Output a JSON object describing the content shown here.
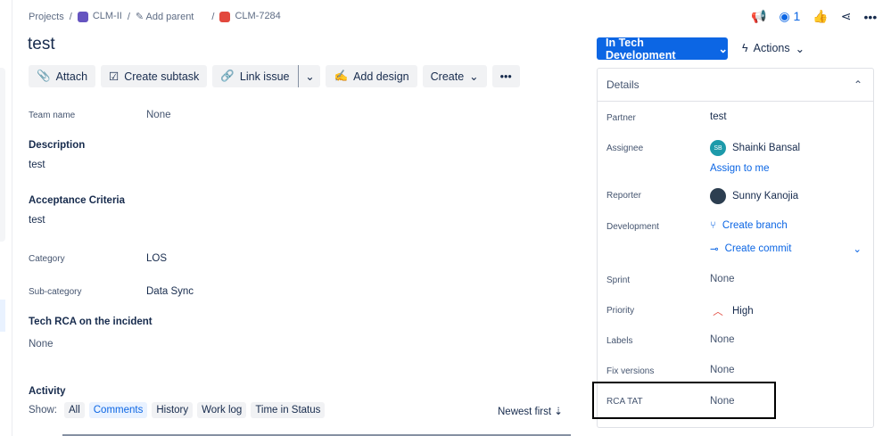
{
  "breadcrumb": {
    "projects": "Projects",
    "project": "CLM-II",
    "add_parent": "Add parent",
    "issue_key": "CLM-7284"
  },
  "title": "test",
  "toolbar": {
    "attach": "Attach",
    "create_subtask": "Create subtask",
    "link_issue": "Link issue",
    "add_design": "Add design",
    "create": "Create"
  },
  "fields": {
    "team_name_label": "Team name",
    "team_name": "None",
    "description_label": "Description",
    "description": "test",
    "acceptance_label": "Acceptance Criteria",
    "acceptance": "test",
    "category_label": "Category",
    "category": "LOS",
    "subcategory_label": "Sub-category",
    "subcategory": "Data Sync",
    "rca_label": "Tech RCA on the incident",
    "rca": "None"
  },
  "activity": {
    "title": "Activity",
    "show": "Show:",
    "filters": [
      "All",
      "Comments",
      "History",
      "Work log",
      "Time in Status"
    ],
    "sort": "Newest first"
  },
  "header": {
    "watchers": "1",
    "status": "In Tech Development",
    "actions": "Actions"
  },
  "details": {
    "title": "Details",
    "partner_label": "Partner",
    "partner": "test",
    "assignee_label": "Assignee",
    "assignee": "Shainki Bansal",
    "assignee_initials": "SB",
    "assign_to_me": "Assign to me",
    "reporter_label": "Reporter",
    "reporter": "Sunny Kanojia",
    "development_label": "Development",
    "create_branch": "Create branch",
    "create_commit": "Create commit",
    "sprint_label": "Sprint",
    "sprint": "None",
    "priority_label": "Priority",
    "priority": "High",
    "labels_label": "Labels",
    "labels": "None",
    "fix_label": "Fix versions",
    "fix": "None",
    "rcatat_label": "RCA TAT",
    "rcatat": "None"
  },
  "colors": {
    "primary": "#0c66e4",
    "priority_high": "#e2483d"
  }
}
